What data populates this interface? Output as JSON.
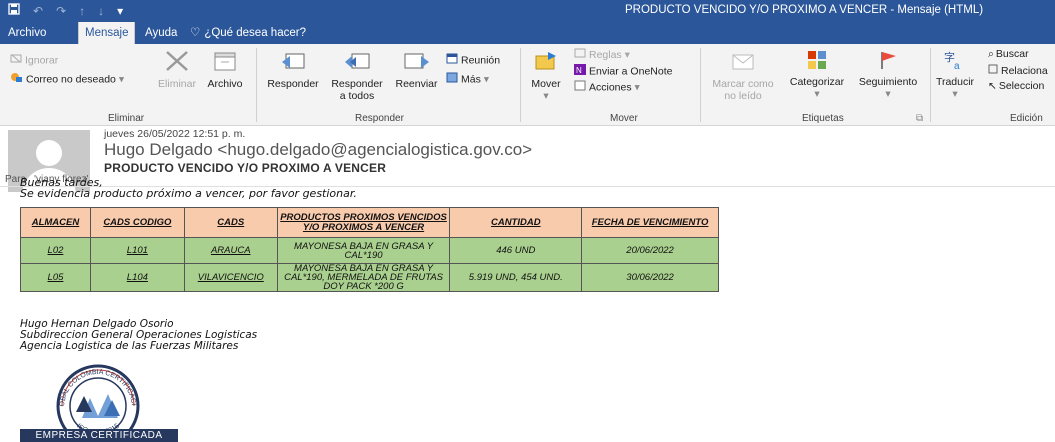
{
  "titlebar": {
    "title": "PRODUCTO VENCIDO Y/O PROXIMO A VENCER  -  Mensaje (HTML)",
    "qat_icons": [
      "save-icon",
      "undo-icon",
      "redo-icon",
      "up-icon",
      "down-icon",
      "customize-icon"
    ]
  },
  "tabs": [
    {
      "label": "Archivo"
    },
    {
      "label": "Mensaje"
    },
    {
      "label": "Ayuda"
    },
    {
      "label": "¿Qué desea hacer?"
    }
  ],
  "ribbon": {
    "eliminar": {
      "ignorar": "Ignorar",
      "correo_no_deseado": "Correo no deseado",
      "eliminar": "Eliminar",
      "archivo": "Archivo",
      "group": "Eliminar"
    },
    "responder": {
      "responder": "Responder",
      "responder_todos_1": "Responder",
      "responder_todos_2": "a todos",
      "reenviar": "Reenviar",
      "reunion": "Reunión",
      "mas": "Más",
      "group": "Responder"
    },
    "mover": {
      "mover": "Mover",
      "reglas": "Reglas",
      "onenote": "Enviar a OneNote",
      "acciones": "Acciones",
      "group": "Mover"
    },
    "etiquetas": {
      "marcar_1": "Marcar como",
      "marcar_2": "no leído",
      "categorizar": "Categorizar",
      "seguimiento": "Seguimiento",
      "group": "Etiquetas"
    },
    "edicion": {
      "traducir": "Traducir",
      "buscar": "Buscar",
      "relacionado": "Relaciona",
      "seleccionar": "Seleccion",
      "group": "Edición"
    }
  },
  "message": {
    "date": "jueves 26/05/2022 12:51 p. m.",
    "sender": "Hugo Delgado <hugo.delgado@agencialogistica.gov.co>",
    "subject": "PRODUCTO VENCIDO Y/O PROXIMO A VENCER",
    "to_label": "Para",
    "to_value": "'viany florez'"
  },
  "body": {
    "greeting": "Buenas tardes,",
    "line": "Se evidencia producto próximo a vencer, por favor gestionar.",
    "table": {
      "headers": [
        "ALMACEN",
        "CADS CODIGO",
        "CADS",
        "PRODUCTOS PROXIMOS VENCIDOS Y/O PROXIMOS A VENCER",
        "CANTIDAD",
        "FECHA DE VENCIMIENTO"
      ],
      "rows": [
        [
          "L02",
          "L101",
          "ARAUCA",
          "MAYONESA BAJA EN GRASA Y CAL*190",
          "446 UND",
          "20/06/2022"
        ],
        [
          "L05",
          "L104",
          "VILAVICENCIO",
          "MAYONESA BAJA EN GRASA Y CAL*190, MERMELADA DE FRUTAS DOY PACK *200 G",
          "5.919 UND, 454 UND.",
          "30/06/2022"
        ]
      ]
    },
    "signature": [
      "Hugo Hernan Delgado Osorio",
      "Subdireccion General Operaciones Logisticas",
      "Agencia Logistica de las Fuerzas Militares"
    ],
    "logo": {
      "ring_text_top": "GLOBAL COLOMBIA CERTIFICACIÓN",
      "ring_text_bottom": "ISO 9001:2015",
      "band": "EMPRESA CERTIFICADA"
    }
  },
  "colors": {
    "accent": "#2b579a",
    "table_header": "#f8cbad",
    "table_row": "#a9d08e"
  }
}
